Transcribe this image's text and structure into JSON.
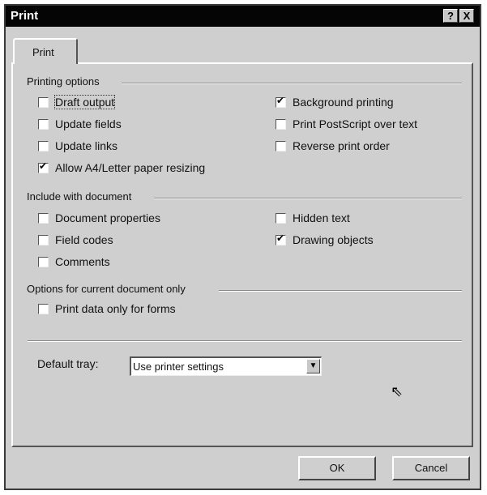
{
  "window": {
    "title": "Print"
  },
  "title_buttons": {
    "help": "?",
    "close": "X"
  },
  "tabs": [
    {
      "label": "Print"
    }
  ],
  "printing_options": {
    "label": "Printing options",
    "items": [
      {
        "label": "Draft output",
        "checked": false
      },
      {
        "label": "Update fields",
        "checked": false
      },
      {
        "label": "Update links",
        "checked": false
      },
      {
        "label": "Allow A4/Letter paper resizing",
        "checked": true
      },
      {
        "label": "Background printing",
        "checked": true
      },
      {
        "label": "Print PostScript over text",
        "checked": false
      },
      {
        "label": "Reverse print order",
        "checked": false
      }
    ]
  },
  "include_with_document": {
    "label": "Include with document",
    "items": [
      {
        "label": "Document properties",
        "checked": false
      },
      {
        "label": "Field codes",
        "checked": false
      },
      {
        "label": "Comments",
        "checked": false
      },
      {
        "label": "Hidden text",
        "checked": false
      },
      {
        "label": "Drawing objects",
        "checked": true
      }
    ]
  },
  "current_document_options": {
    "label": "Options for current document only",
    "items": [
      {
        "label": "Print data only for forms",
        "checked": false
      }
    ]
  },
  "default_tray": {
    "label": "Default tray:",
    "value": "Use printer settings"
  },
  "buttons": {
    "ok": "OK",
    "cancel": "Cancel"
  }
}
